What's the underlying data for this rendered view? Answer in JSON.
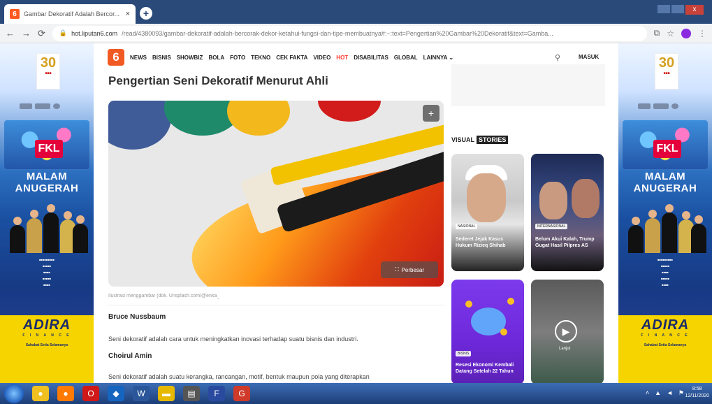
{
  "browser": {
    "tab_title": "Gambar Dekoratif Adalah Bercor...",
    "tab_close": "×",
    "new_tab": "+",
    "url_host": "hot.liputan6.com",
    "url_path": "/read/4380093/gambar-dekoratif-adalah-bercorak-dekor-ketahui-fungsi-dan-tipe-membuatnya#:~:text=Pengertian%20Gambar%20Dekoratif&text=Gamba..."
  },
  "site": {
    "logo": "6",
    "nav": [
      "NEWS",
      "BISNIS",
      "SHOWBIZ",
      "BOLA",
      "FOTO",
      "TEKNO",
      "CEK FAKTA",
      "VIDEO",
      "HOT",
      "DISABILITAS",
      "GLOBAL",
      "LAINNYA ⌄"
    ],
    "login": "MASUK"
  },
  "banner": {
    "anniversary": "30",
    "event_line1": "MALAM",
    "event_line2": "ANUGERAH",
    "sponsor": "ADIRA",
    "sponsor_sub": "F I N A N C E",
    "sponsor_tag": "Sahabat Setia Selamanya",
    "badge": "FKL"
  },
  "article": {
    "title": "Pengertian Seni Dekoratif Menurut Ahli",
    "enlarge": "Perbesar",
    "caption": "Ilustrasi menggambar (dok. Unsplash.com/@enka_",
    "expert1": "Bruce Nussbaum",
    "text1": "Seni dekoratif adalah cara untuk meningkatkan inovasi terhadap suatu bisnis dan industri.",
    "expert2": "Choirul Amin",
    "text2": "Seni dekoratif adalah suatu kerangka, rancangan, motif, bentuk maupun pola yang diterapkan"
  },
  "sidebar": {
    "vs_label_a": "VISUAL",
    "vs_label_b": "STORIES",
    "stories": [
      {
        "badge": "NASIONAL",
        "title": "Sederet Jejak Kasus Hukum Rizieq Shihab"
      },
      {
        "badge": "INTERNASIONAL",
        "title": "Belum Akui Kalah, Trump Gugat Hasil Pilpres AS"
      },
      {
        "badge": "BISNIS",
        "title": "Resesi Ekonomi Kembali Datang Setelah 22 Tahun"
      },
      {
        "badge": "",
        "title": "",
        "play_label": "Lanjut"
      }
    ]
  },
  "taskbar": {
    "time": "8:58",
    "date": "12/11/2020"
  }
}
